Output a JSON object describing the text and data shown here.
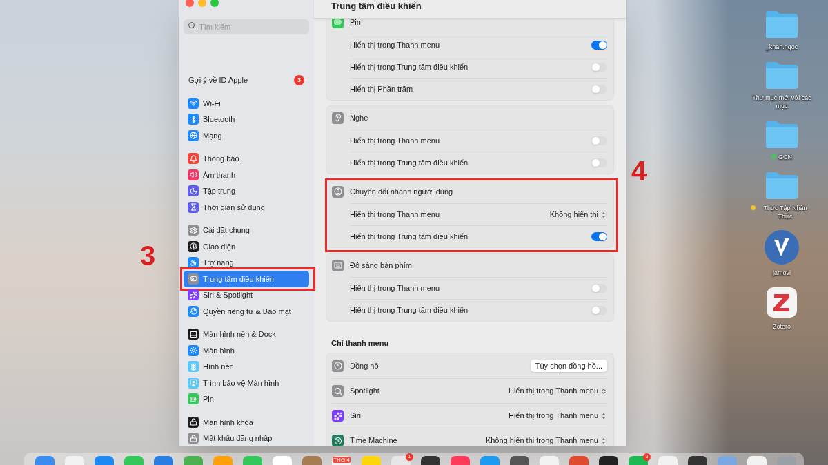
{
  "window": {
    "title": "Trung tâm điều khiển",
    "search": {
      "placeholder": "Tìm kiếm"
    },
    "sidebar": {
      "apple_id": {
        "label": "Gợi ý về ID Apple",
        "badge": "3"
      },
      "groups": [
        [
          {
            "label": "Wi-Fi",
            "selected": false
          },
          {
            "label": "Bluetooth",
            "selected": false
          },
          {
            "label": "Mạng",
            "selected": false
          }
        ],
        [
          {
            "label": "Thông báo",
            "selected": false
          },
          {
            "label": "Âm thanh",
            "selected": false
          },
          {
            "label": "Tập trung",
            "selected": false
          },
          {
            "label": "Thời gian sử dụng",
            "selected": false
          }
        ],
        [
          {
            "label": "Cài đặt chung",
            "selected": false
          },
          {
            "label": "Giao diện",
            "selected": false
          },
          {
            "label": "Trợ năng",
            "selected": false
          },
          {
            "label": "Trung tâm điều khiển",
            "selected": true,
            "annotation": "3"
          },
          {
            "label": "Siri & Spotlight",
            "selected": false
          },
          {
            "label": "Quyền riêng tư & Bảo mật",
            "selected": false
          }
        ],
        [
          {
            "label": "Màn hình nền & Dock",
            "selected": false
          },
          {
            "label": "Màn hình",
            "selected": false
          },
          {
            "label": "Hình nền",
            "selected": false
          },
          {
            "label": "Trình bảo vệ Màn hình",
            "selected": false
          },
          {
            "label": "Pin",
            "selected": false
          }
        ],
        [
          {
            "label": "Màn hình khóa",
            "selected": false
          },
          {
            "label": "Mật khẩu đăng nhập",
            "selected": false
          }
        ]
      ]
    },
    "sections": [
      {
        "title": "Pin",
        "rows": [
          {
            "kind": "toggle",
            "label": "Hiển thị trong Thanh menu",
            "on": true
          },
          {
            "kind": "toggle",
            "label": "Hiển thị trong Trung tâm điều khiển",
            "on": false
          },
          {
            "kind": "toggle",
            "label": "Hiển thị Phần trăm",
            "on": false
          }
        ]
      },
      {
        "title": "Nghe",
        "rows": [
          {
            "kind": "toggle",
            "label": "Hiển thị trong Thanh menu",
            "on": false
          },
          {
            "kind": "toggle",
            "label": "Hiển thị trong Trung tâm điều khiển",
            "on": false
          }
        ]
      },
      {
        "title": "Chuyển đổi nhanh người dùng",
        "annotation": "4",
        "rows": [
          {
            "kind": "select",
            "label": "Hiển thị trong Thanh menu",
            "value": "Không hiển thị"
          },
          {
            "kind": "toggle",
            "label": "Hiển thị trong Trung tâm điều khiển",
            "on": true
          }
        ]
      },
      {
        "title": "Độ sáng bàn phím",
        "rows": [
          {
            "kind": "toggle",
            "label": "Hiển thị trong Thanh menu",
            "on": false
          },
          {
            "kind": "toggle",
            "label": "Hiển thị trong Trung tâm điều khiển",
            "on": false
          }
        ]
      }
    ],
    "menu_bar_only": {
      "heading": "Chỉ thanh menu",
      "rows": [
        {
          "kind": "button",
          "label": "Đồng hồ",
          "value": "Tùy chọn đồng hồ..."
        },
        {
          "kind": "select",
          "label": "Spotlight",
          "value": "Hiển thị trong Thanh menu"
        },
        {
          "kind": "select",
          "label": "Siri",
          "value": "Hiển thị trong Thanh menu"
        },
        {
          "kind": "select",
          "label": "Time Machine",
          "value": "Không hiển thị trong Thanh menu"
        }
      ]
    }
  },
  "desktop": [
    {
      "kind": "folder",
      "label": "_knah.nqoc"
    },
    {
      "kind": "folder",
      "label": "Thư mục mới với các mục"
    },
    {
      "kind": "folder",
      "label": "GCN",
      "color": "#4cc35a"
    },
    {
      "kind": "folder",
      "label": "Thực Tập Nhận Thức",
      "color": "#f2c52a"
    },
    {
      "kind": "jamovi",
      "label": "jamovi"
    },
    {
      "kind": "zotero",
      "label": "Zotero"
    }
  ],
  "dock": {
    "calendar_label": "THG 4",
    "badges": [
      "1",
      "3"
    ]
  }
}
